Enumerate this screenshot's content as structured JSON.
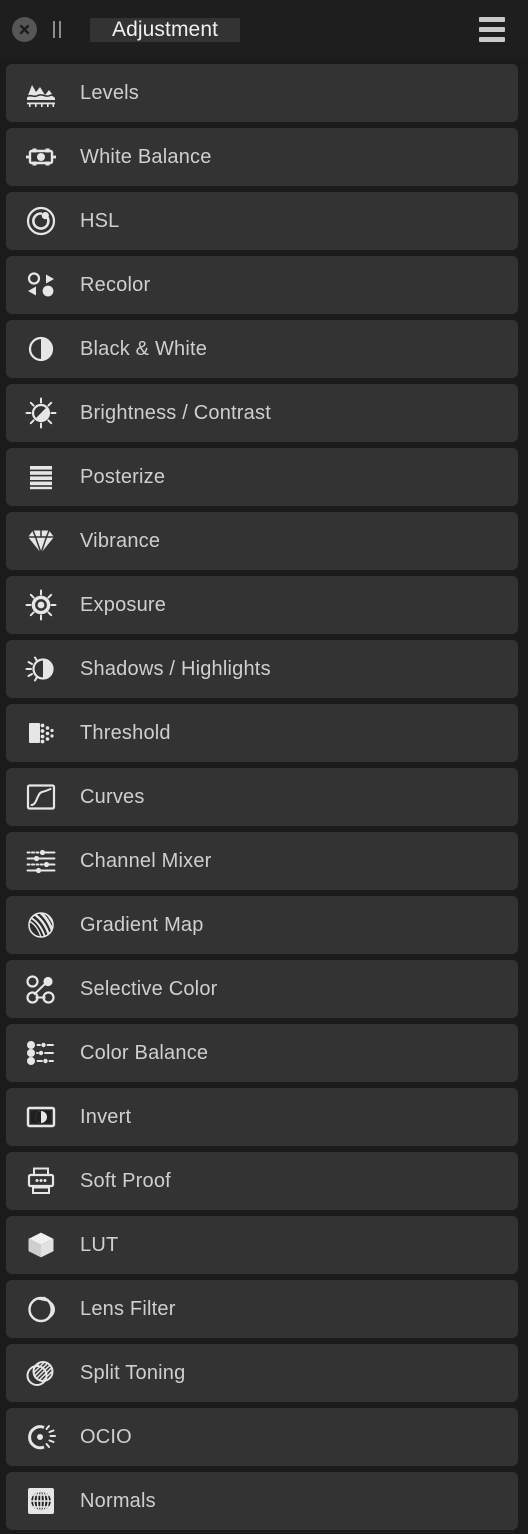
{
  "window": {
    "title": "Adjustment",
    "close_icon": "close-circle-icon",
    "drag_handle_icon": "drag-handle-icon",
    "menu_icon": "hamburger-menu-icon",
    "active_tab": "Adjustment"
  },
  "colors": {
    "panel_background": "#1b1b1b",
    "titlebar_background": "#1e1e1e",
    "tab_active_background": "#333333",
    "row_background": "#333333",
    "row_label": "#cfcfcf",
    "icon": "#e6e6e6",
    "close_icon_circle": "#565656",
    "menu_icon_color": "#c9c9c9"
  },
  "adjustments": [
    {
      "label": "Levels",
      "icon": "levels-histogram-icon"
    },
    {
      "label": "White Balance",
      "icon": "white-balance-icon"
    },
    {
      "label": "HSL",
      "icon": "hsl-color-wheel-icon"
    },
    {
      "label": "Recolor",
      "icon": "recolor-icon"
    },
    {
      "label": "Black & White",
      "icon": "black-and-white-circle-icon"
    },
    {
      "label": "Brightness / Contrast",
      "icon": "brightness-contrast-sun-icon"
    },
    {
      "label": "Posterize",
      "icon": "posterize-bars-icon"
    },
    {
      "label": "Vibrance",
      "icon": "vibrance-gem-icon"
    },
    {
      "label": "Exposure",
      "icon": "exposure-sun-icon"
    },
    {
      "label": "Shadows / Highlights",
      "icon": "shadows-highlights-icon"
    },
    {
      "label": "Threshold",
      "icon": "threshold-dither-icon"
    },
    {
      "label": "Curves",
      "icon": "curves-graph-icon"
    },
    {
      "label": "Channel Mixer",
      "icon": "channel-mixer-sliders-icon"
    },
    {
      "label": "Gradient Map",
      "icon": "gradient-map-sphere-icon"
    },
    {
      "label": "Selective Color",
      "icon": "selective-color-nodes-icon"
    },
    {
      "label": "Color Balance",
      "icon": "color-balance-sliders-icon"
    },
    {
      "label": "Invert",
      "icon": "invert-icon"
    },
    {
      "label": "Soft Proof",
      "icon": "soft-proof-printer-icon"
    },
    {
      "label": "LUT",
      "icon": "lut-cube-icon"
    },
    {
      "label": "Lens Filter",
      "icon": "lens-filter-icon"
    },
    {
      "label": "Split Toning",
      "icon": "split-toning-icon"
    },
    {
      "label": "OCIO",
      "icon": "ocio-icon"
    },
    {
      "label": "Normals",
      "icon": "normals-sphere-grid-icon"
    }
  ]
}
